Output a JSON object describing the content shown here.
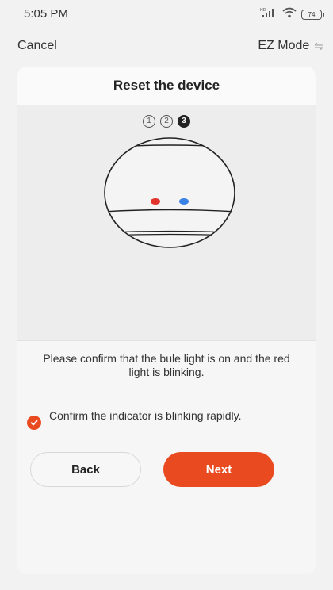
{
  "status_bar": {
    "time": "5:05 PM",
    "battery": "74",
    "icons": [
      "hd-signal-icon",
      "wifi-icon",
      "battery-icon"
    ]
  },
  "nav": {
    "cancel_label": "Cancel",
    "mode_label": "EZ Mode",
    "mode_icon": "swap-icon"
  },
  "card": {
    "title": "Reset the device",
    "steps": [
      "1",
      "2",
      "3"
    ],
    "active_step": 3,
    "indicator_colors": {
      "red": "#e0342c",
      "blue": "#3b82e6"
    },
    "instruction": "Please confirm that the bule light is on and the red light is blinking."
  },
  "confirm": {
    "checked": true,
    "label": "Confirm the indicator is blinking rapidly."
  },
  "buttons": {
    "back_label": "Back",
    "next_label": "Next"
  },
  "colors": {
    "accent": "#e94a1f"
  }
}
